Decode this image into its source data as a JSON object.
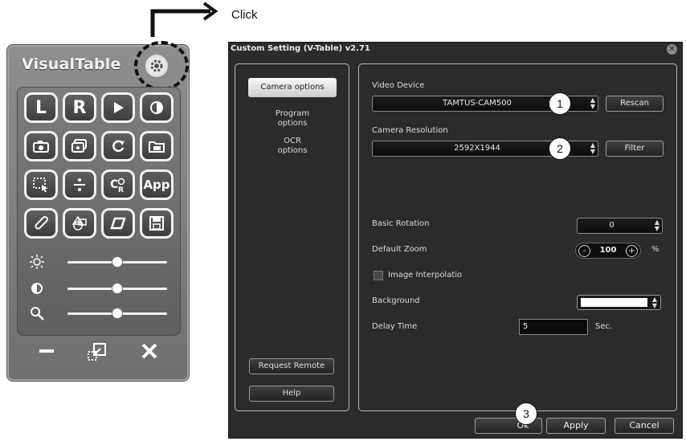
{
  "annotation": {
    "click_label": "Click",
    "markers": [
      "1",
      "2",
      "3"
    ]
  },
  "widget": {
    "title": "VisualTable",
    "buttons": [
      "L",
      "R",
      "App"
    ],
    "icons": [
      "gear-icon",
      "play-icon",
      "contrast-icon",
      "camera-icon",
      "multi-camera-icon",
      "refresh-icon",
      "image-folder-icon",
      "select-area-icon",
      "divide-icon",
      "ocr-icon",
      "pen-icon",
      "shapes-icon",
      "eraser-icon",
      "save-icon",
      "brightness-icon",
      "contrast-icon",
      "magnifier-icon",
      "minimize-icon",
      "restore-icon",
      "close-icon"
    ],
    "sliders": [
      0.5,
      0.5,
      0.5
    ]
  },
  "dialog": {
    "title": "Custom Setting (V-Table) v2.71",
    "nav": {
      "active": "Camera options",
      "program": [
        "Program",
        "options"
      ],
      "ocr": [
        "OCR",
        "options"
      ],
      "request_remote": "Request Remote",
      "help": "Help"
    },
    "video_device": {
      "label": "Video Device",
      "value": "TAMTUS-CAM500",
      "button": "Rescan"
    },
    "camera_resolution": {
      "label": "Camera Resolution",
      "value": "2592X1944",
      "button": "Filter"
    },
    "basic_rotation": {
      "label": "Basic Rotation",
      "value": "0"
    },
    "default_zoom": {
      "label": "Default Zoom",
      "minus": "-",
      "value": "100",
      "plus": "+",
      "unit": "%"
    },
    "image_interpolation": {
      "label": "Image Interpolatio",
      "checked": false
    },
    "background": {
      "label": "Background",
      "color": "#ffffff"
    },
    "delay_time": {
      "label": "Delay Time",
      "value": "5",
      "unit": "Sec."
    },
    "footer": {
      "ok": "Ok",
      "apply": "Apply",
      "cancel": "Cancel"
    }
  }
}
